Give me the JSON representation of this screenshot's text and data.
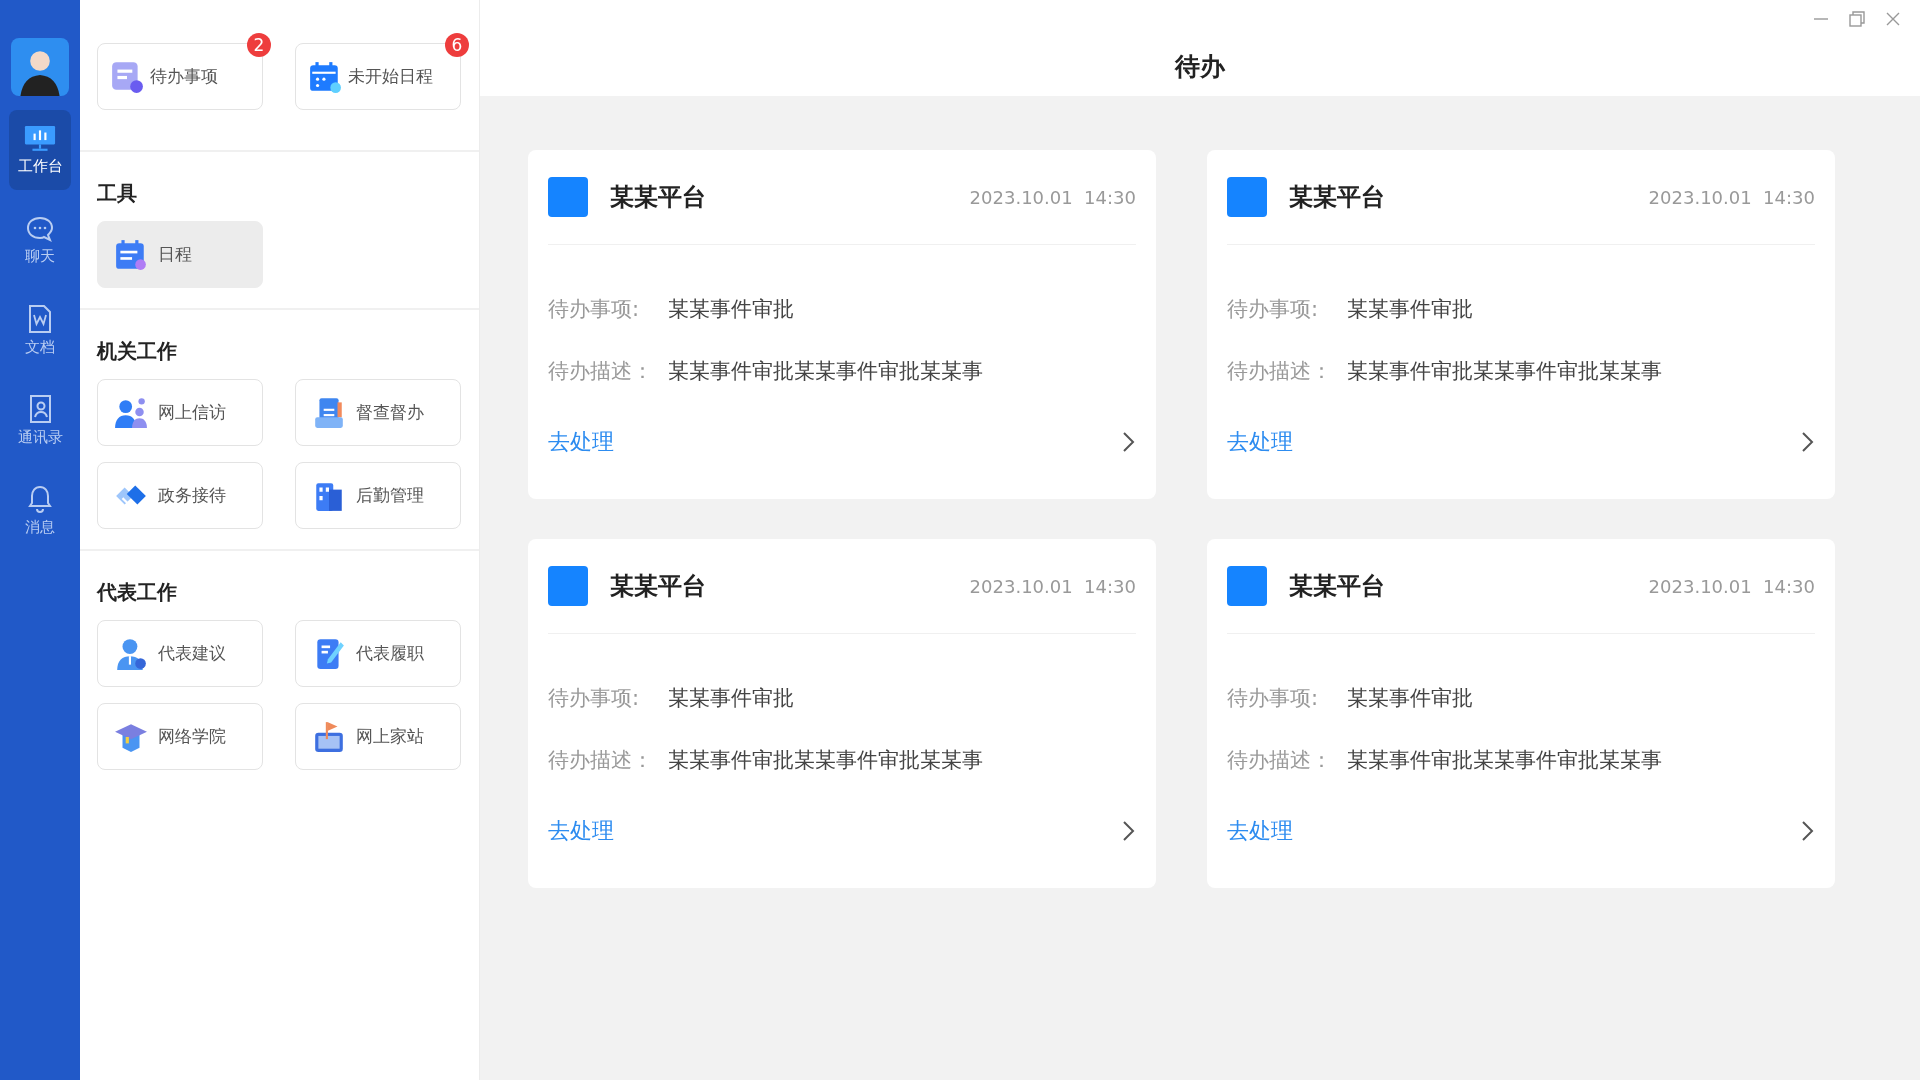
{
  "nav": [
    {
      "label": "工作台",
      "kind": "dashboard",
      "selected": true
    },
    {
      "label": "聊天",
      "kind": "chat",
      "selected": false
    },
    {
      "label": "文档",
      "kind": "doc",
      "selected": false
    },
    {
      "label": "通讯录",
      "kind": "contacts",
      "selected": false
    },
    {
      "label": "消息",
      "kind": "bell",
      "selected": false
    }
  ],
  "quick": [
    {
      "label": "待办事项",
      "kind": "todo",
      "badge": "2"
    },
    {
      "label": "未开始日程",
      "kind": "calendar",
      "badge": "6"
    }
  ],
  "sections": [
    {
      "title": "工具",
      "tiles": [
        {
          "label": "日程",
          "kind": "schedule",
          "selected": true
        }
      ]
    },
    {
      "title": "机关工作",
      "tiles": [
        {
          "label": "网上信访",
          "kind": "people",
          "selected": false
        },
        {
          "label": "督查督办",
          "kind": "clipboard",
          "selected": false
        },
        {
          "label": "政务接待",
          "kind": "handshake",
          "selected": false
        },
        {
          "label": "后勤管理",
          "kind": "building",
          "selected": false
        }
      ]
    },
    {
      "title": "代表工作",
      "tiles": [
        {
          "label": "代表建议",
          "kind": "person",
          "selected": false
        },
        {
          "label": "代表履职",
          "kind": "notebook",
          "selected": false
        },
        {
          "label": "网络学院",
          "kind": "cap",
          "selected": false
        },
        {
          "label": "网上家站",
          "kind": "flag",
          "selected": false
        }
      ]
    }
  ],
  "page_title": "待办",
  "cards": [
    {
      "platform": "某某平台",
      "time": "2023.10.01  14:30",
      "item_label": "待办事项:",
      "item": "某某事件审批",
      "desc_label": "待办描述：",
      "desc": "某某事件审批某某事件审批某某事",
      "action": "去处理"
    },
    {
      "platform": "某某平台",
      "time": "2023.10.01  14:30",
      "item_label": "待办事项:",
      "item": "某某事件审批",
      "desc_label": "待办描述：",
      "desc": "某某事件审批某某事件审批某某事",
      "action": "去处理"
    },
    {
      "platform": "某某平台",
      "time": "2023.10.01  14:30",
      "item_label": "待办事项:",
      "item": "某某事件审批",
      "desc_label": "待办描述：",
      "desc": "某某事件审批某某事件审批某某事",
      "action": "去处理"
    },
    {
      "platform": "某某平台",
      "time": "2023.10.01  14:30",
      "item_label": "待办事项:",
      "item": "某某事件审批",
      "desc_label": "待办描述：",
      "desc": "某某事件审批某某事件审批某某事",
      "action": "去处理"
    }
  ]
}
